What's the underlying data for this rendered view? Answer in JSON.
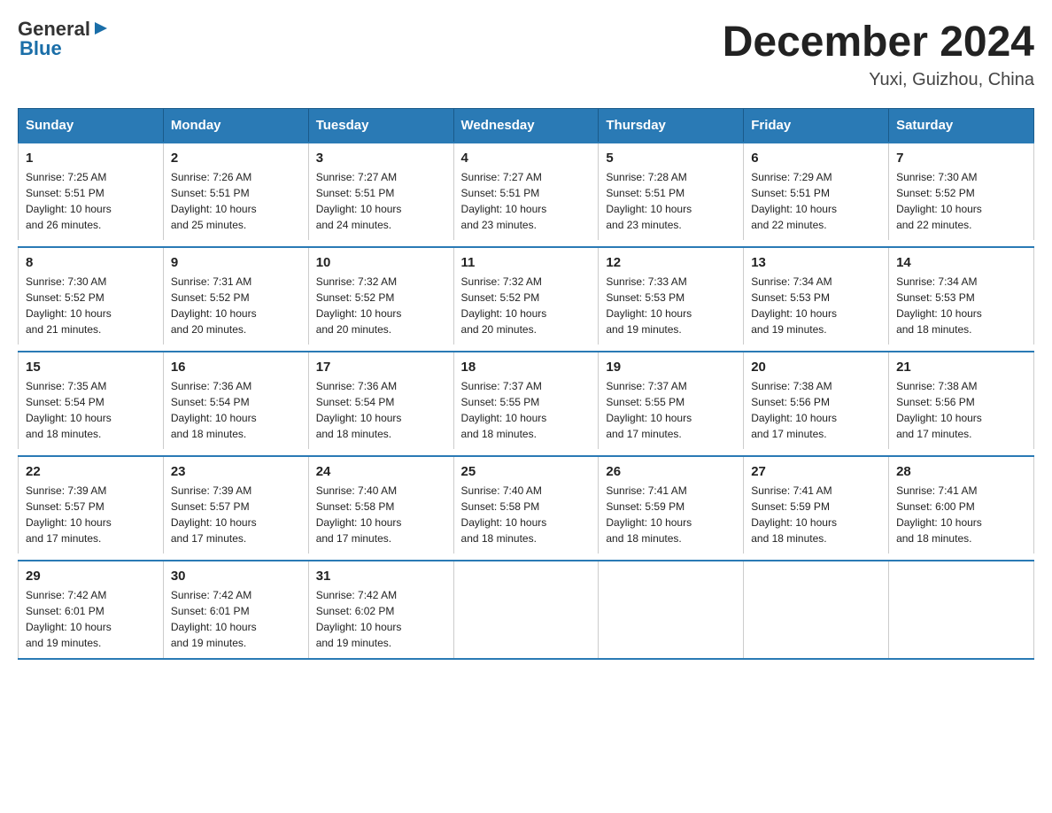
{
  "logo": {
    "general": "General",
    "blue": "Blue",
    "arrow": "▶"
  },
  "title": "December 2024",
  "subtitle": "Yuxi, Guizhou, China",
  "days_of_week": [
    "Sunday",
    "Monday",
    "Tuesday",
    "Wednesday",
    "Thursday",
    "Friday",
    "Saturday"
  ],
  "weeks": [
    [
      {
        "day": "1",
        "sunrise": "7:25 AM",
        "sunset": "5:51 PM",
        "daylight": "10 hours and 26 minutes."
      },
      {
        "day": "2",
        "sunrise": "7:26 AM",
        "sunset": "5:51 PM",
        "daylight": "10 hours and 25 minutes."
      },
      {
        "day": "3",
        "sunrise": "7:27 AM",
        "sunset": "5:51 PM",
        "daylight": "10 hours and 24 minutes."
      },
      {
        "day": "4",
        "sunrise": "7:27 AM",
        "sunset": "5:51 PM",
        "daylight": "10 hours and 23 minutes."
      },
      {
        "day": "5",
        "sunrise": "7:28 AM",
        "sunset": "5:51 PM",
        "daylight": "10 hours and 23 minutes."
      },
      {
        "day": "6",
        "sunrise": "7:29 AM",
        "sunset": "5:51 PM",
        "daylight": "10 hours and 22 minutes."
      },
      {
        "day": "7",
        "sunrise": "7:30 AM",
        "sunset": "5:52 PM",
        "daylight": "10 hours and 22 minutes."
      }
    ],
    [
      {
        "day": "8",
        "sunrise": "7:30 AM",
        "sunset": "5:52 PM",
        "daylight": "10 hours and 21 minutes."
      },
      {
        "day": "9",
        "sunrise": "7:31 AM",
        "sunset": "5:52 PM",
        "daylight": "10 hours and 20 minutes."
      },
      {
        "day": "10",
        "sunrise": "7:32 AM",
        "sunset": "5:52 PM",
        "daylight": "10 hours and 20 minutes."
      },
      {
        "day": "11",
        "sunrise": "7:32 AM",
        "sunset": "5:52 PM",
        "daylight": "10 hours and 20 minutes."
      },
      {
        "day": "12",
        "sunrise": "7:33 AM",
        "sunset": "5:53 PM",
        "daylight": "10 hours and 19 minutes."
      },
      {
        "day": "13",
        "sunrise": "7:34 AM",
        "sunset": "5:53 PM",
        "daylight": "10 hours and 19 minutes."
      },
      {
        "day": "14",
        "sunrise": "7:34 AM",
        "sunset": "5:53 PM",
        "daylight": "10 hours and 18 minutes."
      }
    ],
    [
      {
        "day": "15",
        "sunrise": "7:35 AM",
        "sunset": "5:54 PM",
        "daylight": "10 hours and 18 minutes."
      },
      {
        "day": "16",
        "sunrise": "7:36 AM",
        "sunset": "5:54 PM",
        "daylight": "10 hours and 18 minutes."
      },
      {
        "day": "17",
        "sunrise": "7:36 AM",
        "sunset": "5:54 PM",
        "daylight": "10 hours and 18 minutes."
      },
      {
        "day": "18",
        "sunrise": "7:37 AM",
        "sunset": "5:55 PM",
        "daylight": "10 hours and 18 minutes."
      },
      {
        "day": "19",
        "sunrise": "7:37 AM",
        "sunset": "5:55 PM",
        "daylight": "10 hours and 17 minutes."
      },
      {
        "day": "20",
        "sunrise": "7:38 AM",
        "sunset": "5:56 PM",
        "daylight": "10 hours and 17 minutes."
      },
      {
        "day": "21",
        "sunrise": "7:38 AM",
        "sunset": "5:56 PM",
        "daylight": "10 hours and 17 minutes."
      }
    ],
    [
      {
        "day": "22",
        "sunrise": "7:39 AM",
        "sunset": "5:57 PM",
        "daylight": "10 hours and 17 minutes."
      },
      {
        "day": "23",
        "sunrise": "7:39 AM",
        "sunset": "5:57 PM",
        "daylight": "10 hours and 17 minutes."
      },
      {
        "day": "24",
        "sunrise": "7:40 AM",
        "sunset": "5:58 PM",
        "daylight": "10 hours and 17 minutes."
      },
      {
        "day": "25",
        "sunrise": "7:40 AM",
        "sunset": "5:58 PM",
        "daylight": "10 hours and 18 minutes."
      },
      {
        "day": "26",
        "sunrise": "7:41 AM",
        "sunset": "5:59 PM",
        "daylight": "10 hours and 18 minutes."
      },
      {
        "day": "27",
        "sunrise": "7:41 AM",
        "sunset": "5:59 PM",
        "daylight": "10 hours and 18 minutes."
      },
      {
        "day": "28",
        "sunrise": "7:41 AM",
        "sunset": "6:00 PM",
        "daylight": "10 hours and 18 minutes."
      }
    ],
    [
      {
        "day": "29",
        "sunrise": "7:42 AM",
        "sunset": "6:01 PM",
        "daylight": "10 hours and 19 minutes."
      },
      {
        "day": "30",
        "sunrise": "7:42 AM",
        "sunset": "6:01 PM",
        "daylight": "10 hours and 19 minutes."
      },
      {
        "day": "31",
        "sunrise": "7:42 AM",
        "sunset": "6:02 PM",
        "daylight": "10 hours and 19 minutes."
      },
      null,
      null,
      null,
      null
    ]
  ],
  "labels": {
    "sunrise": "Sunrise:",
    "sunset": "Sunset:",
    "daylight": "Daylight:"
  }
}
